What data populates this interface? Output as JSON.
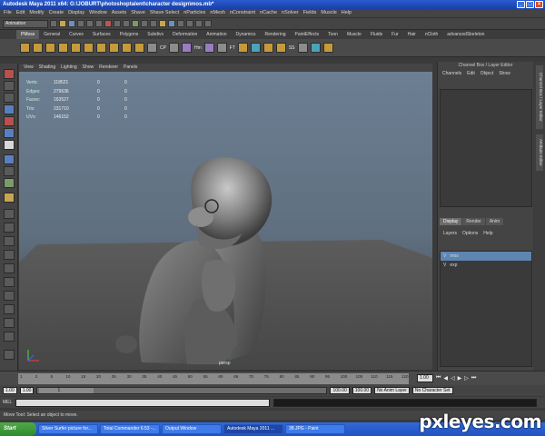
{
  "window": {
    "title": "Autodesk Maya 2011 x64: G:\\JOBURT\\photoshoptalent\\character design\\mos.mb*"
  },
  "menubar": [
    "File",
    "Edit",
    "Modify",
    "Create",
    "Display",
    "Window",
    "Assets",
    "Shave",
    "Shave Select",
    "nParticles",
    "nMesh",
    "nConstraint",
    "nCache",
    "nSolver",
    "Fields",
    "Muscle",
    "Help"
  ],
  "statusline": {
    "mode": "Animation"
  },
  "shelf": {
    "tabs": [
      "PMoss",
      "General",
      "Curves",
      "Surfaces",
      "Polygons",
      "Subdivs",
      "Deformation",
      "Animation",
      "Dynamics",
      "Rendering",
      "PaintEffects",
      "Toon",
      "Muscle",
      "Fluids",
      "Fur",
      "Hair",
      "nCloth",
      "advancedSkeleton"
    ],
    "active_tab": "PMoss",
    "labels": [
      "CP",
      "Hm",
      "FT",
      "SS"
    ]
  },
  "panel_menu": [
    "View",
    "Shading",
    "Lighting",
    "Show",
    "Renderer",
    "Panels"
  ],
  "hud": [
    {
      "label": "Verts:",
      "value": "118521",
      "a": "0",
      "b": "0"
    },
    {
      "label": "Edges:",
      "value": "279636",
      "a": "0",
      "b": "0"
    },
    {
      "label": "Faces:",
      "value": "163527",
      "a": "0",
      "b": "0"
    },
    {
      "label": "Tris:",
      "value": "231710",
      "a": "0",
      "b": "0"
    },
    {
      "label": "UVs:",
      "value": "146152",
      "a": "0",
      "b": "0"
    }
  ],
  "viewport": {
    "camera": "persp"
  },
  "channel_box": {
    "title": "Channel Box / Layer Editor",
    "menu": [
      "Channels",
      "Edit",
      "Object",
      "Show"
    ],
    "layer_tabs": [
      "Display",
      "Render",
      "Anim"
    ],
    "layer_menu": [
      "Layers",
      "Options",
      "Help"
    ],
    "layers": [
      {
        "visible": "V",
        "name": "mos",
        "selected": true
      },
      {
        "visible": "V",
        "name": "exp",
        "selected": false
      }
    ],
    "side_tabs": [
      "Channel Box / Layer Editor",
      "Attribute Editor"
    ]
  },
  "timeline": {
    "ticks": [
      "1",
      "2",
      "5",
      "10",
      "15",
      "20",
      "25",
      "30",
      "35",
      "40",
      "45",
      "50",
      "55",
      "60",
      "65",
      "70",
      "75",
      "80",
      "85",
      "90",
      "95",
      "100",
      "105",
      "110",
      "115",
      "120"
    ],
    "current_frame": "1.00"
  },
  "range": {
    "start": "1.00",
    "start2": "1.00",
    "range_label": "1",
    "range_end": "100",
    "end": "100.00",
    "end2": "100.00",
    "anim_layer": "No Anim Layer",
    "char_set": "No Character Set"
  },
  "mel": {
    "label": "MEL"
  },
  "help_line": "Move Tool: Select an object to move.",
  "taskbar": {
    "start": "Start",
    "tasks": [
      {
        "label": "Silver Surfer picture for...",
        "active": false
      },
      {
        "label": "Total Commander 6.53 -...",
        "active": false
      },
      {
        "label": "Output Window",
        "active": false
      },
      {
        "label": "Autodesk Maya 2011 ...",
        "active": true
      },
      {
        "label": "38.JPG - Paint",
        "active": false
      }
    ]
  },
  "watermark": "pxleyes.com"
}
